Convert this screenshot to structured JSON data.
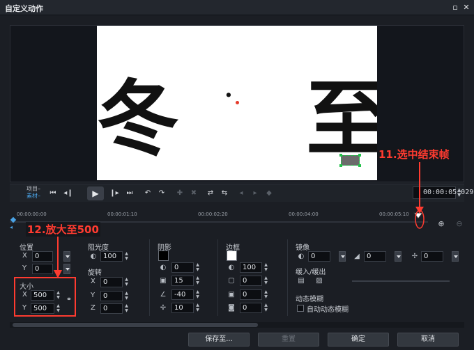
{
  "window": {
    "title": "自定义动作"
  },
  "preview": {
    "chars": [
      "冬",
      "·",
      "至"
    ]
  },
  "playback": {
    "mode_project": "项目–",
    "mode_clip": "素材–",
    "timecode": "00:00:05:029"
  },
  "ruler": {
    "ticks": [
      "00:00:00:00",
      "00:00:01:10",
      "00:00:02:20",
      "00:00:04:00",
      "00:00:05:10"
    ]
  },
  "annotations": {
    "end_frame": "11.选中结束帧",
    "scale": "12.放大至500"
  },
  "position": {
    "title": "位置",
    "x_label": "X",
    "x": "0",
    "y_label": "Y",
    "y": "0"
  },
  "size": {
    "title": "大小",
    "x_label": "X",
    "x": "500",
    "y_label": "Y",
    "y": "500"
  },
  "glow": {
    "title": "阻光度",
    "value": "100"
  },
  "rotation": {
    "title": "旋转",
    "x_label": "X",
    "x": "0",
    "y_label": "Y",
    "y": "0",
    "z_label": "Z",
    "z": "0"
  },
  "shadow": {
    "title": "阴影",
    "color": "#000000",
    "v1": "0",
    "v2": "15",
    "v3": "-40",
    "v4": "10"
  },
  "border": {
    "title": "边框",
    "color": "#ffffff",
    "v1": "100",
    "v2": "0",
    "v3": "0",
    "v4": "0"
  },
  "mirror": {
    "title": "镜像",
    "v1": "0",
    "v2": "0",
    "v3": "0"
  },
  "ease": {
    "title": "缓入/缓出"
  },
  "motion_blur": {
    "title": "动态模糊",
    "auto_label": "自动动态模糊"
  },
  "footer": {
    "save_to": "保存至...",
    "reset": "重置",
    "ok": "确定",
    "cancel": "取消"
  },
  "colors": {
    "accent_red": "#ff3b30",
    "select_green": "#23c24a"
  }
}
